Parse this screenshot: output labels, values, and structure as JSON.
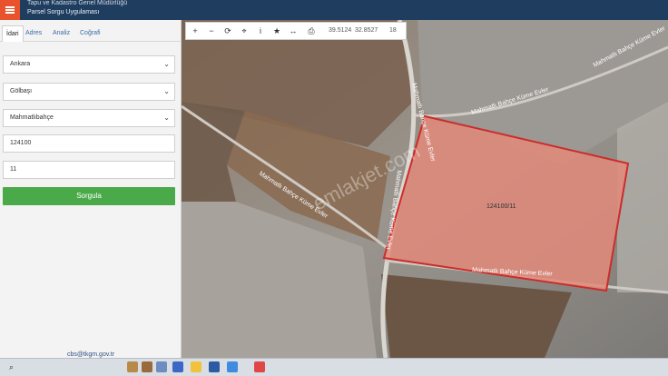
{
  "header": {
    "org_name": "Tapu ve Kadastro Genel Müdürlüğü",
    "app_name": "Parsel Sorgu Uygulaması"
  },
  "panel": {
    "tabs": [
      "İdari",
      "Adres",
      "Analiz",
      "Coğrafi"
    ],
    "active_tab": "İdari",
    "province": "Ankara",
    "district": "Gölbaşı",
    "neighborhood": "Mahmatlıbahçe",
    "block_no": "124100",
    "parcel_no": "11",
    "query_button": "Sorgula",
    "contact_email": "cbs@tkgm.gov.tr"
  },
  "toolbar": {
    "coordinates": {
      "lat": "39.5124",
      "lon": "32.8527"
    },
    "zoom": "18"
  },
  "map": {
    "road_labels": [
      "Mahmatlı Bahçe Küme Evler",
      "Mahmatlı Bahçe Küme Evler",
      "Mahmatlı Bahçe Küme Evler",
      "Mahmatlı Bahçe Küme Evler",
      "Mahmatlı Bahçe Küme Evler",
      "Mahmatlı Bahçe Küme Evler"
    ],
    "parcel_label": "124100/11",
    "watermark": "emlakjet.com"
  },
  "colors": {
    "header_bg": "#1f3d5e",
    "menu_button": "#e8522c",
    "query_button": "#4aaa4a",
    "parcel_fill": "#e28a7a",
    "parcel_stroke": "#cc2c2a"
  }
}
